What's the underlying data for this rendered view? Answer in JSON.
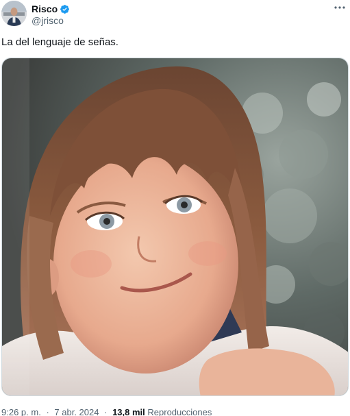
{
  "author": {
    "display_name": "Risco",
    "handle": "@jrisco",
    "verified": true,
    "avatar_icon": "profile-avatar",
    "verified_icon": "verified-badge-icon"
  },
  "tweet": {
    "text": "La del lenguaje de señas.",
    "time": "9:26 p. m.",
    "date": "7 abr. 2024",
    "views_count": "13,8 mil",
    "views_label": "Reproducciones",
    "separator": "·"
  },
  "media": {
    "type": "photo",
    "icon": "photo-child-portrait"
  },
  "colors": {
    "verified_blue": "#1d9bf0",
    "primary_text": "#0f1419",
    "secondary_text": "#536471",
    "border": "#cfd9de"
  }
}
